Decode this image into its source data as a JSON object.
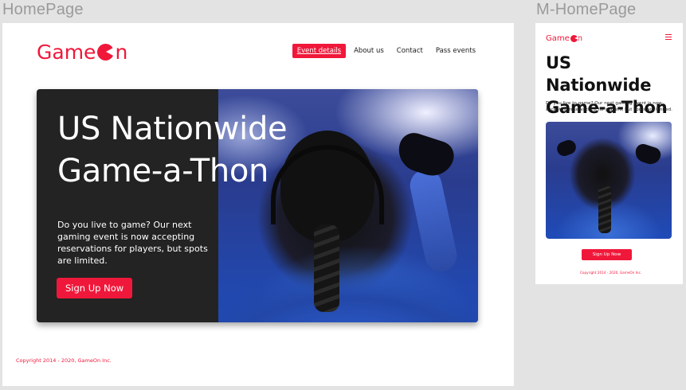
{
  "frames": {
    "desktop_label": "HomePage",
    "mobile_label": "M-HomePage"
  },
  "brand": {
    "name_before": "Game",
    "name_after": "n",
    "accent_color": "#f0183a"
  },
  "nav": {
    "items": [
      {
        "label": "Event details",
        "active": true
      },
      {
        "label": "About us",
        "active": false
      },
      {
        "label": "Contact",
        "active": false
      },
      {
        "label": "Pass events",
        "active": false
      }
    ]
  },
  "hero": {
    "title_line1": "US Nationwide",
    "title_line2": "Game-a-Thon",
    "description": "Do you live to game? Our next gaming event is now accepting reservations for players, but spots are limited.",
    "cta_label": "Sign Up Now",
    "image_icon": "gamer-photo"
  },
  "footer": {
    "copyright": "Copyright 2014 - 2020, GameOn Inc."
  },
  "mobile": {
    "menu_icon": "hamburger-icon"
  }
}
